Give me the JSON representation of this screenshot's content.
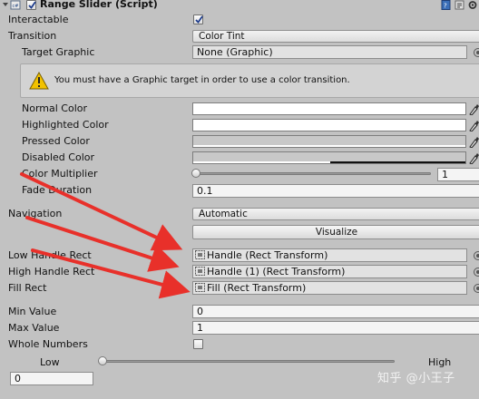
{
  "component": {
    "title": "Range Slider (Script)",
    "enabled": true
  },
  "props": {
    "interactable_label": "Interactable",
    "interactable_checked": true,
    "transition_label": "Transition",
    "transition_value": "Color Tint",
    "target_graphic_label": "Target Graphic",
    "target_graphic_value": "None (Graphic)",
    "warning_text": "You must have a Graphic target in order to use a color transition.",
    "normal_color_label": "Normal Color",
    "highlighted_color_label": "Highlighted Color",
    "pressed_color_label": "Pressed Color",
    "disabled_color_label": "Disabled Color",
    "color_multiplier_label": "Color Multiplier",
    "color_multiplier_value": "1",
    "fade_duration_label": "Fade Duration",
    "fade_duration_value": "0.1",
    "navigation_label": "Navigation",
    "navigation_value": "Automatic",
    "visualize_label": "Visualize",
    "low_handle_label": "Low Handle Rect",
    "low_handle_value": "Handle (Rect Transform)",
    "high_handle_label": "High Handle Rect",
    "high_handle_value": "Handle (1) (Rect Transform)",
    "fill_rect_label": "Fill Rect",
    "fill_rect_value": "Fill (Rect Transform)",
    "min_value_label": "Min Value",
    "min_value_value": "0",
    "max_value_label": "Max Value",
    "max_value_value": "1",
    "whole_numbers_label": "Whole Numbers",
    "whole_numbers_checked": false,
    "low_label": "Low",
    "high_label": "High",
    "low_value": "0"
  },
  "watermark": "知乎 @小王子",
  "colors": {
    "panel_bg": "#c2c2c2",
    "annotation_arrow": "#e8302a",
    "warning_yellow": "#f2c200"
  }
}
